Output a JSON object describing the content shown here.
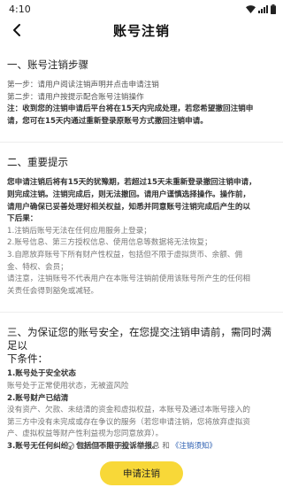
{
  "status_bar": {
    "time": "4:10"
  },
  "nav": {
    "title": "账号注销"
  },
  "section1": {
    "title": "一、账号注销步骤",
    "step1": "第一步：请用户阅读注销声明并点击申请注销",
    "step2": "第二步：请用户按提示配合账号注销操作",
    "note": [
      "注：收到您的注销申请后平台将在15天内完成处理，若您希望撤回注销申",
      "请，您可在15天内通过重新登录原账号方式撤回注销申请。"
    ]
  },
  "section2": {
    "title": "二、重要提示",
    "bold_lines": [
      "您申请注销后将有15天的犹豫期，若超过15天未重新登录撤回注销申请，",
      "则完成注销。注销完成后，则无法撤回。请用户谨慎选择操作。操作前，",
      "请用户确保已妥善处理好相关权益，知悉并同意账号注销完成后产生的以",
      "下后果："
    ],
    "item1": "1.注销后账号无法在任何应用服务上登录；",
    "item2": "2.账号信息、第三方授权信息、使用信息等数据将无法恢复；",
    "item3": [
      "3.自愿放弃账号下所有财产性权益，包括但不限于虚拟货币、余额、佣",
      "金、特权、会员；"
    ],
    "item4": [
      "请注意，注销账号不代表用户在本账号注销前使用该账号所产生的任何相",
      "关责任会得到豁免或减轻。"
    ]
  },
  "section3": {
    "title_lines": [
      "三、为保证您的账号安全，在您提交注销申请前，需同时满足以",
      "下条件："
    ],
    "cond1_title": "1.账号处于安全状态",
    "cond1_body": "账号处于正常使用状态，无被盗风险",
    "cond2_title": "2.账号财产已结清",
    "cond2_body": [
      "没有资产、欠款、未结清的资金和虚拟权益，本账号及通过本账号接入的",
      "第三方中没有未完成或存在争议的服务（若您申请注销，您将放弃虚拟资",
      "产、虚拟权益等财产性利益视为您同意放弃）。"
    ],
    "cond3_title": "3.账号无任何纠纷，包括但不限于投诉举报。"
  },
  "footer": {
    "agree_text": "我已阅读并同意以上信息 和",
    "agree_link": "《注销须知》",
    "apply_button": "申请注销"
  }
}
